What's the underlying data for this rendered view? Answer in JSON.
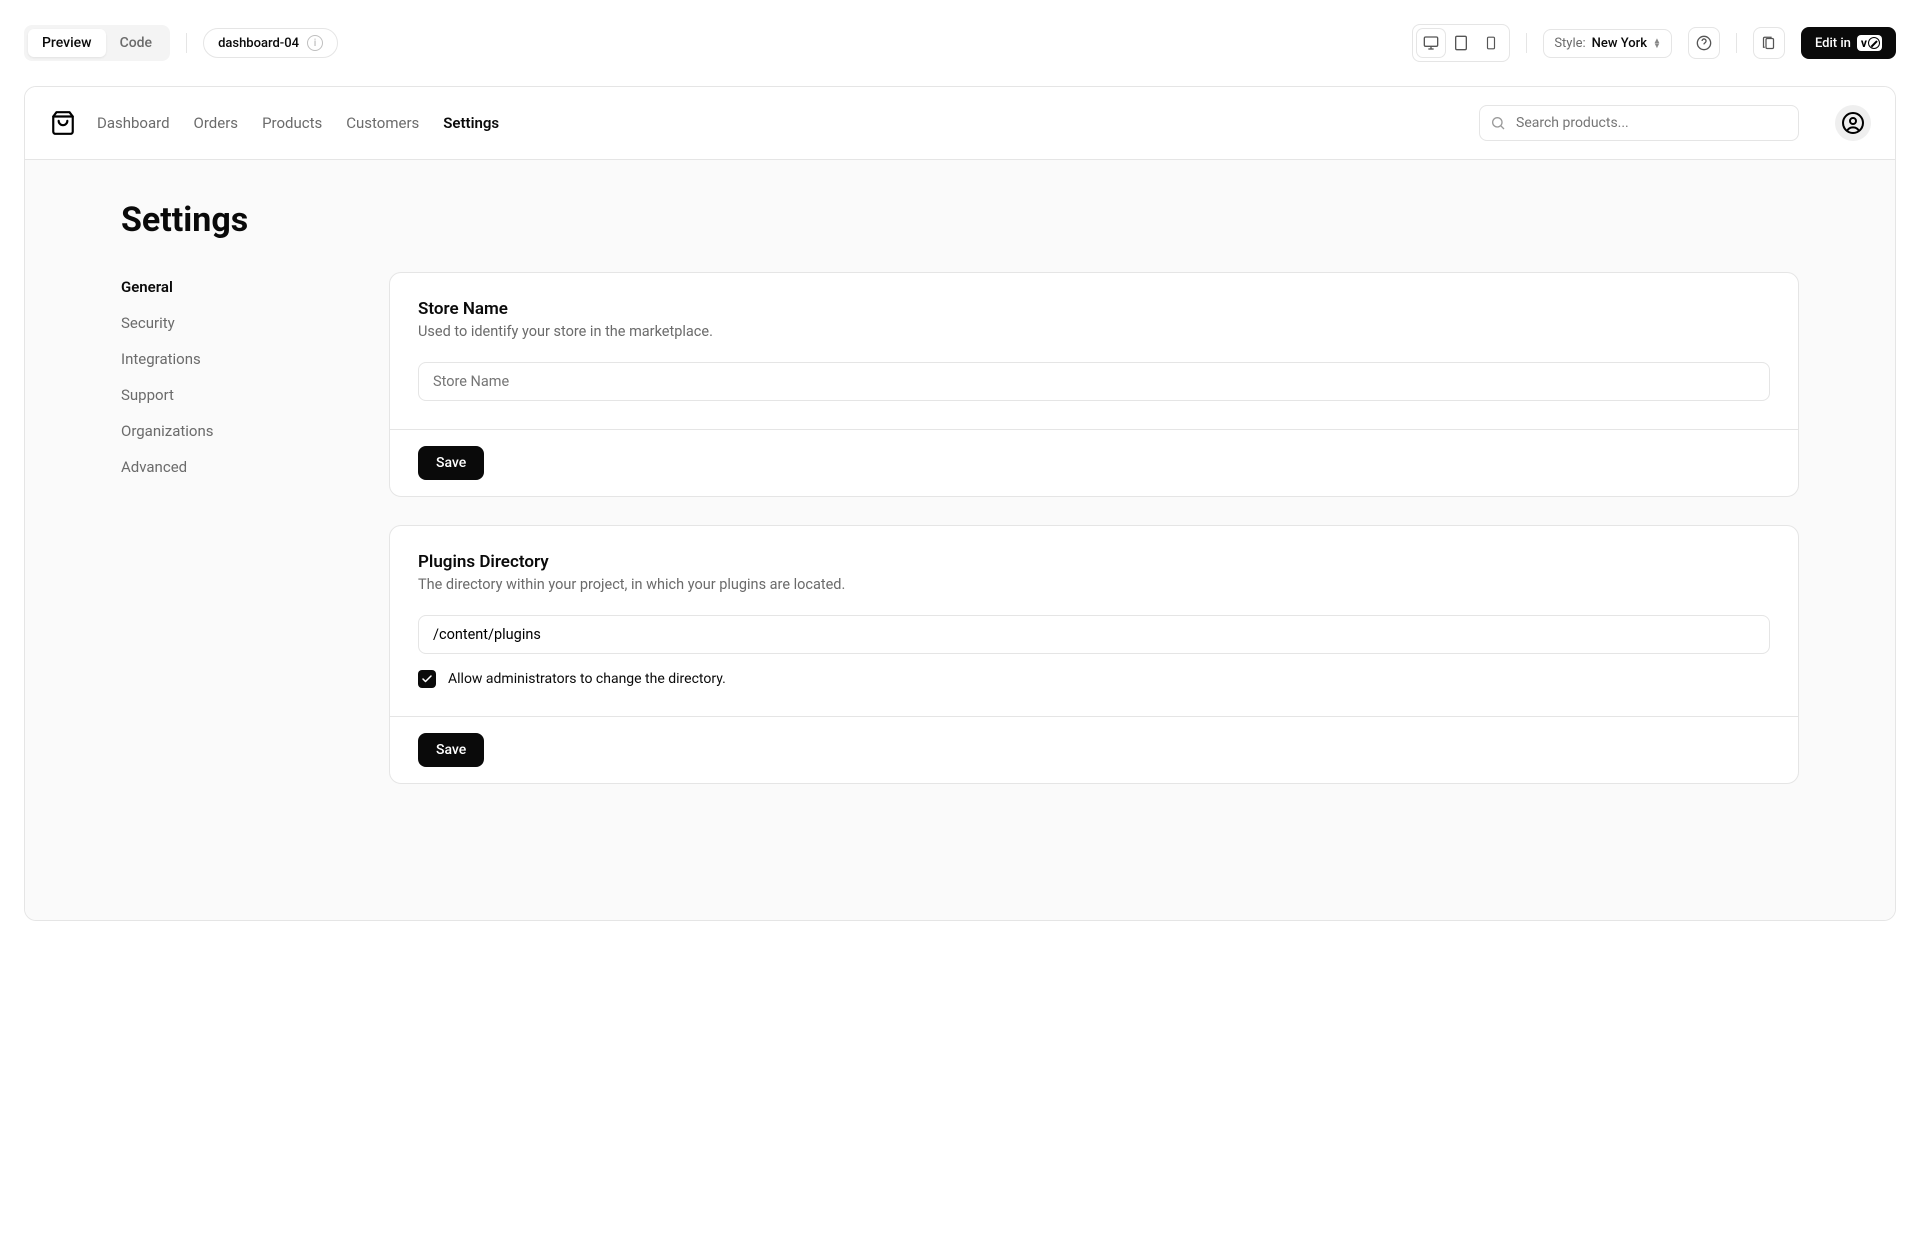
{
  "toolbar": {
    "preview_label": "Preview",
    "code_label": "Code",
    "block_name": "dashboard-04",
    "style_label": "Style:",
    "style_value": "New York",
    "edit_in_label": "Edit in"
  },
  "header": {
    "nav": [
      "Dashboard",
      "Orders",
      "Products",
      "Customers",
      "Settings"
    ],
    "active_nav": "Settings",
    "search_placeholder": "Search products..."
  },
  "page": {
    "title": "Settings",
    "sidebar": [
      "General",
      "Security",
      "Integrations",
      "Support",
      "Organizations",
      "Advanced"
    ],
    "active_side": "General"
  },
  "cards": {
    "store": {
      "title": "Store Name",
      "desc": "Used to identify your store in the marketplace.",
      "placeholder": "Store Name",
      "value": "",
      "save": "Save"
    },
    "plugins": {
      "title": "Plugins Directory",
      "desc": "The directory within your project, in which your plugins are located.",
      "value": "/content/plugins",
      "checkbox_label": "Allow administrators to change the directory.",
      "checkbox_checked": true,
      "save": "Save"
    }
  }
}
